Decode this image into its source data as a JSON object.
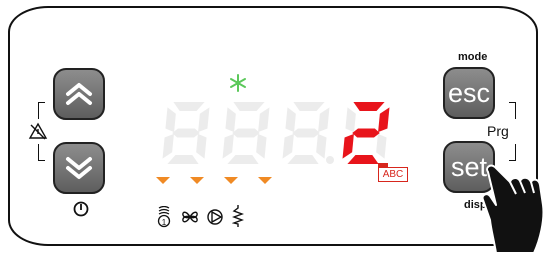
{
  "display": {
    "digits": [
      "8",
      "8",
      "8",
      "2"
    ],
    "active_digit_color": "#e8141b",
    "inactive_digit_color": "#ececec",
    "snowflake_color": "#5bc85a",
    "arrow_color": "#f08a24"
  },
  "buttons": {
    "esc_label": "esc",
    "set_label": "set"
  },
  "labels": {
    "mode": "mode",
    "prg": "Prg",
    "disp": "disp",
    "abc": "ABC"
  },
  "icons": [
    "up-chevrons-icon",
    "down-chevrons-icon",
    "power-icon",
    "alarm-muted-icon",
    "snowflake-icon",
    "compressor-icon",
    "fan-icon",
    "pump-icon",
    "heater-icon",
    "hand-pointer-icon"
  ]
}
